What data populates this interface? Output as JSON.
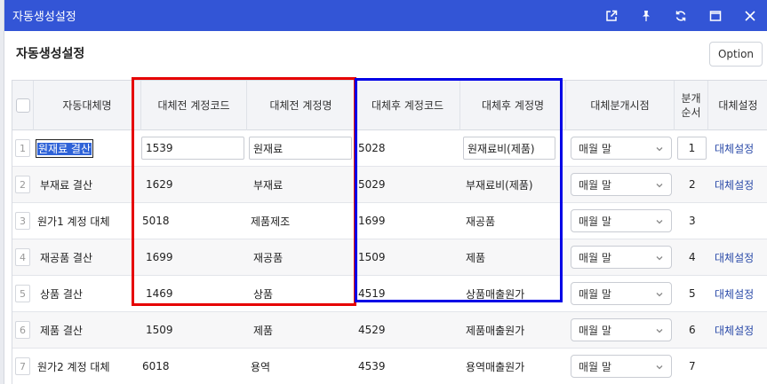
{
  "window": {
    "title": "자동생성설정"
  },
  "page": {
    "title": "자동생성설정",
    "option_label": "Option"
  },
  "columns": {
    "name": "자동대체명",
    "before_code": "대체전 계정코드",
    "before_name": "대체전 계정명",
    "after_code": "대체후 계정코드",
    "after_name": "대체후 계정명",
    "split_time": "대체분개시점",
    "order_line1": "분개",
    "order_line2": "순서",
    "setting": "대체설정"
  },
  "rows": [
    {
      "num": "1",
      "name": "원재료 결산",
      "before_code": "1539",
      "before_name": "원재료",
      "after_code": "5028",
      "after_name": "원재료비(제품)",
      "split_time": "매월 말",
      "order": "1",
      "setting": "대체설정"
    },
    {
      "num": "2",
      "name": "부재료 결산",
      "before_code": "1629",
      "before_name": "부재료",
      "after_code": "5029",
      "after_name": "부재료비(제품)",
      "split_time": "매월 말",
      "order": "2",
      "setting": "대체설정"
    },
    {
      "num": "3",
      "name": "원가1 계정 대체",
      "before_code": "5018",
      "before_name": "제품제조",
      "after_code": "1699",
      "after_name": "재공품",
      "split_time": "매월 말",
      "order": "3",
      "setting": ""
    },
    {
      "num": "4",
      "name": "재공품 결산",
      "before_code": "1699",
      "before_name": "재공품",
      "after_code": "1509",
      "after_name": "제품",
      "split_time": "매월 말",
      "order": "4",
      "setting": "대체설정"
    },
    {
      "num": "5",
      "name": "상품 결산",
      "before_code": "1469",
      "before_name": "상품",
      "after_code": "4519",
      "after_name": "상품매출원가",
      "split_time": "매월 말",
      "order": "5",
      "setting": "대체설정"
    },
    {
      "num": "6",
      "name": "제품 결산",
      "before_code": "1509",
      "before_name": "제품",
      "after_code": "4529",
      "after_name": "제품매출원가",
      "split_time": "매월 말",
      "order": "6",
      "setting": "대체설정"
    },
    {
      "num": "7",
      "name": "원가2 계정 대체",
      "before_code": "6018",
      "before_name": "용역",
      "after_code": "4539",
      "after_name": "용역매출원가",
      "split_time": "매월 말",
      "order": "7",
      "setting": ""
    }
  ],
  "colors": {
    "titlebar": "#3355d6",
    "highlight_red": "#e60000",
    "highlight_blue": "#0000e6",
    "link": "#2a4aa8"
  }
}
